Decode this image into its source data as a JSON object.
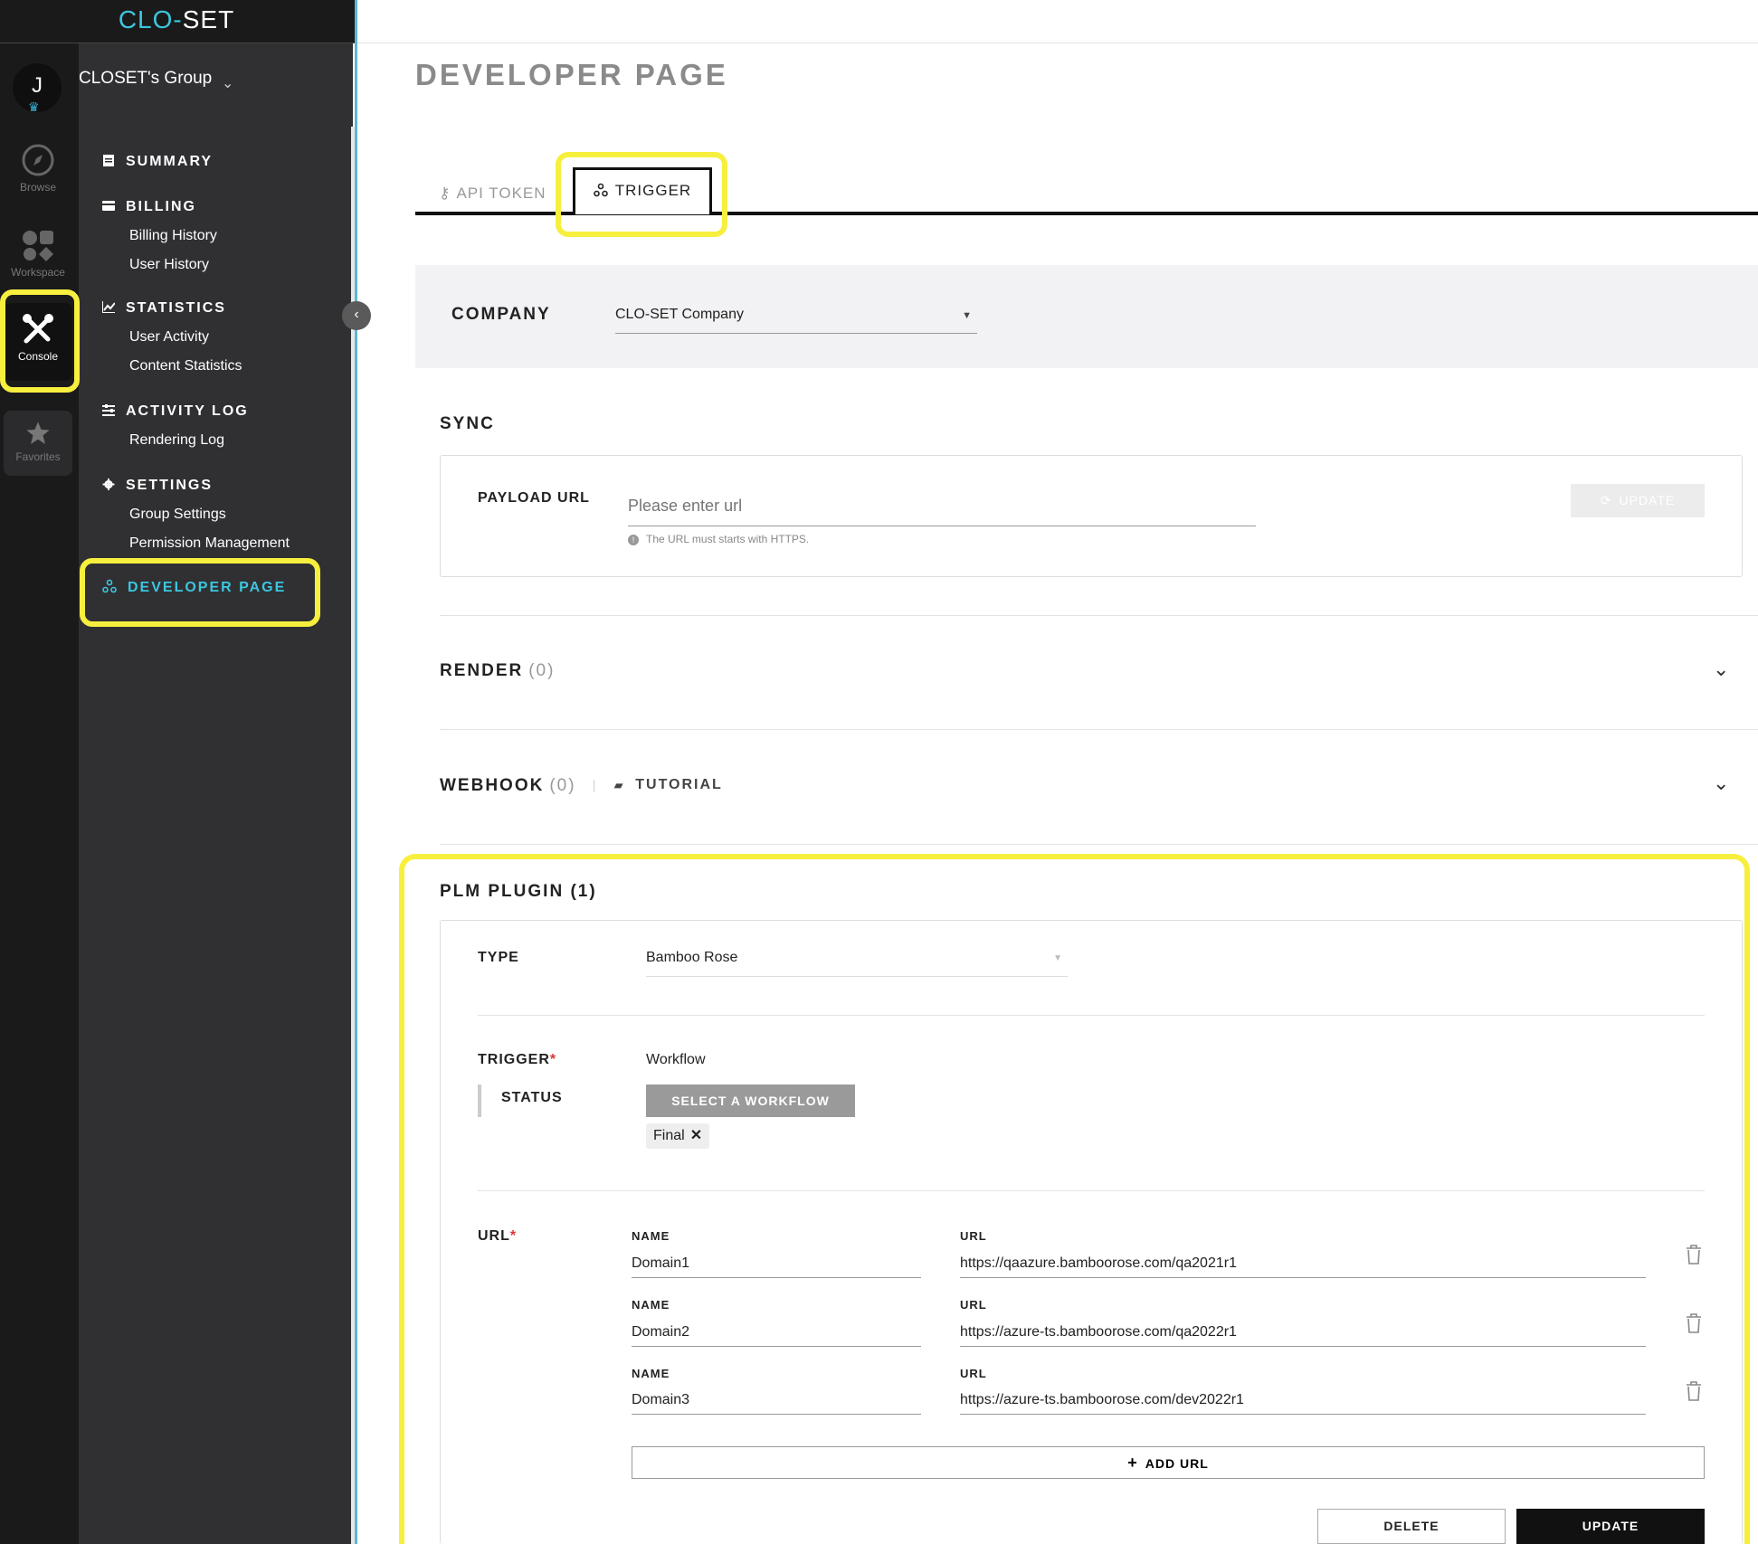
{
  "app": {
    "logo_left": "CLO",
    "logo_right": "SET",
    "logo_mid": "-"
  },
  "user": {
    "initial": "J",
    "group": "CLOSET's Group"
  },
  "rail": [
    {
      "label": "Browse",
      "icon": "compass-icon"
    },
    {
      "label": "Workspace",
      "icon": "grid-icon"
    },
    {
      "label": "Console",
      "icon": "tools-icon"
    },
    {
      "label": "Favorites",
      "icon": "star-icon"
    }
  ],
  "sidebar": {
    "summary": "SUMMARY",
    "billing": "BILLING",
    "billing_history": "Billing History",
    "user_history": "User History",
    "statistics": "STATISTICS",
    "user_activity": "User Activity",
    "content_statistics": "Content Statistics",
    "activity_log": "ACTIVITY LOG",
    "rendering_log": "Rendering Log",
    "settings": "SETTINGS",
    "group_settings": "Group Settings",
    "permission_management": "Permission Management",
    "developer_page": "DEVELOPER PAGE"
  },
  "main": {
    "title": "DEVELOPER PAGE",
    "tabs": {
      "api_token": "API TOKEN",
      "trigger": "TRIGGER"
    },
    "company": {
      "label": "COMPANY",
      "value": "CLO-SET Company"
    },
    "sync": {
      "title": "SYNC",
      "payload_label": "PAYLOAD URL",
      "placeholder": "Please enter url",
      "hint": "The URL must starts with HTTPS.",
      "update": "UPDATE"
    },
    "render": {
      "title": "RENDER",
      "count": "(0)"
    },
    "webhook": {
      "title": "WEBHOOK",
      "count": "(0)",
      "tutorial": "TUTORIAL"
    },
    "plm": {
      "title": "PLM PLUGIN (1)",
      "type_label": "TYPE",
      "type_value": "Bamboo Rose",
      "trigger_label": "TRIGGER",
      "trigger_value": "Workflow",
      "status_label": "STATUS",
      "select_workflow": "SELECT A WORKFLOW",
      "chip": "Final",
      "url_label": "URL",
      "name_header": "NAME",
      "url_header": "URL",
      "urls": [
        {
          "name": "Domain1",
          "url": "https://qaazure.bamboorose.com/qa2021r1"
        },
        {
          "name": "Domain2",
          "url": "https://azure-ts.bamboorose.com/qa2022r1"
        },
        {
          "name": "Domain3",
          "url": "https://azure-ts.bamboorose.com/dev2022r1"
        }
      ],
      "add_url": "ADD URL",
      "delete": "DELETE",
      "update": "UPDATE"
    }
  },
  "colors": {
    "accent": "#3cc6e0",
    "highlight": "#f7ef3e",
    "sidebar": "#303033",
    "rail": "#1a1a1a"
  }
}
